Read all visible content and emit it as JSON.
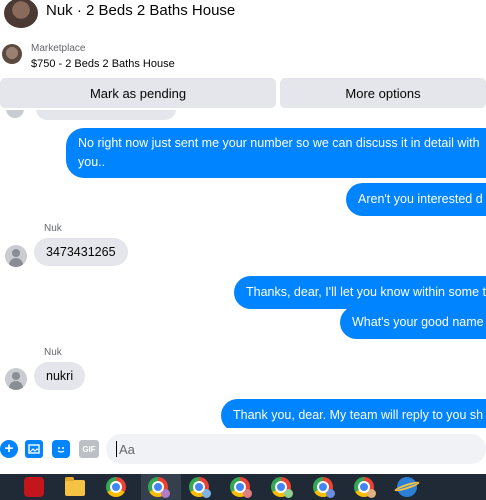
{
  "header": {
    "title": "Nuk · 2 Beds 2 Baths House"
  },
  "marketplace": {
    "label": "Marketplace",
    "listing": "$750 - 2 Beds 2 Baths House",
    "buttons": {
      "pending": "Mark as pending",
      "more": "More options"
    }
  },
  "messages": [
    {
      "from": "me",
      "text_line1": "No right now just sent me your number so we can discuss it in detail with",
      "text_line2": "you.."
    },
    {
      "from": "me",
      "text": "Aren't you interested d"
    },
    {
      "from": "Nuk",
      "sender": "Nuk",
      "text": "3473431265"
    },
    {
      "from": "me",
      "text": "Thanks, dear, I'll let you know within some t"
    },
    {
      "from": "me",
      "text": "What's your good name"
    },
    {
      "from": "Nuk",
      "sender": "Nuk",
      "text": "nukri"
    },
    {
      "from": "me",
      "text": "Thank you, dear. My team will reply to you sh"
    }
  ],
  "composer": {
    "placeholder": "Aa",
    "gif_label": "GIF"
  },
  "colors": {
    "accent": "#0084ff",
    "incoming_bubble": "#e4e6eb"
  },
  "taskbar": {
    "icons": [
      "acrobat-icon",
      "file-explorer-icon",
      "chrome-icon",
      "chrome-profile-icon",
      "chrome-profile-icon",
      "chrome-profile-icon",
      "chrome-profile-icon",
      "chrome-profile-icon",
      "chrome-profile-icon",
      "internet-explorer-icon"
    ]
  }
}
